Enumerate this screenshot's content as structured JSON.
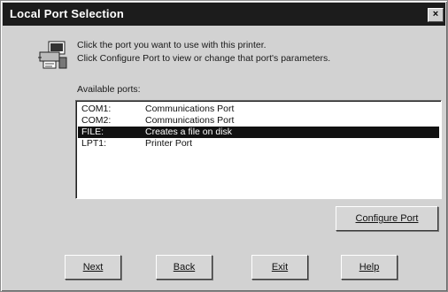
{
  "window": {
    "title": "Local Port Selection",
    "close_glyph": "×"
  },
  "instructions": {
    "line1": "Click the port you want to use with this printer.",
    "line2": "Click Configure Port to view or change that port's parameters."
  },
  "ports": {
    "label": "Available ports:",
    "items": [
      {
        "name": "COM1:",
        "description": "Communications Port",
        "selected": false
      },
      {
        "name": "COM2:",
        "description": "Communications Port",
        "selected": false
      },
      {
        "name": "FILE:",
        "description": "Creates a file on disk",
        "selected": true
      },
      {
        "name": "LPT1:",
        "description": "Printer Port",
        "selected": false
      }
    ]
  },
  "buttons": {
    "configure": "Configure Port",
    "next": "Next",
    "back": "Back",
    "exit": "Exit",
    "help": "Help"
  },
  "icons": {
    "wizard": "printer-port-wizard-icon"
  }
}
